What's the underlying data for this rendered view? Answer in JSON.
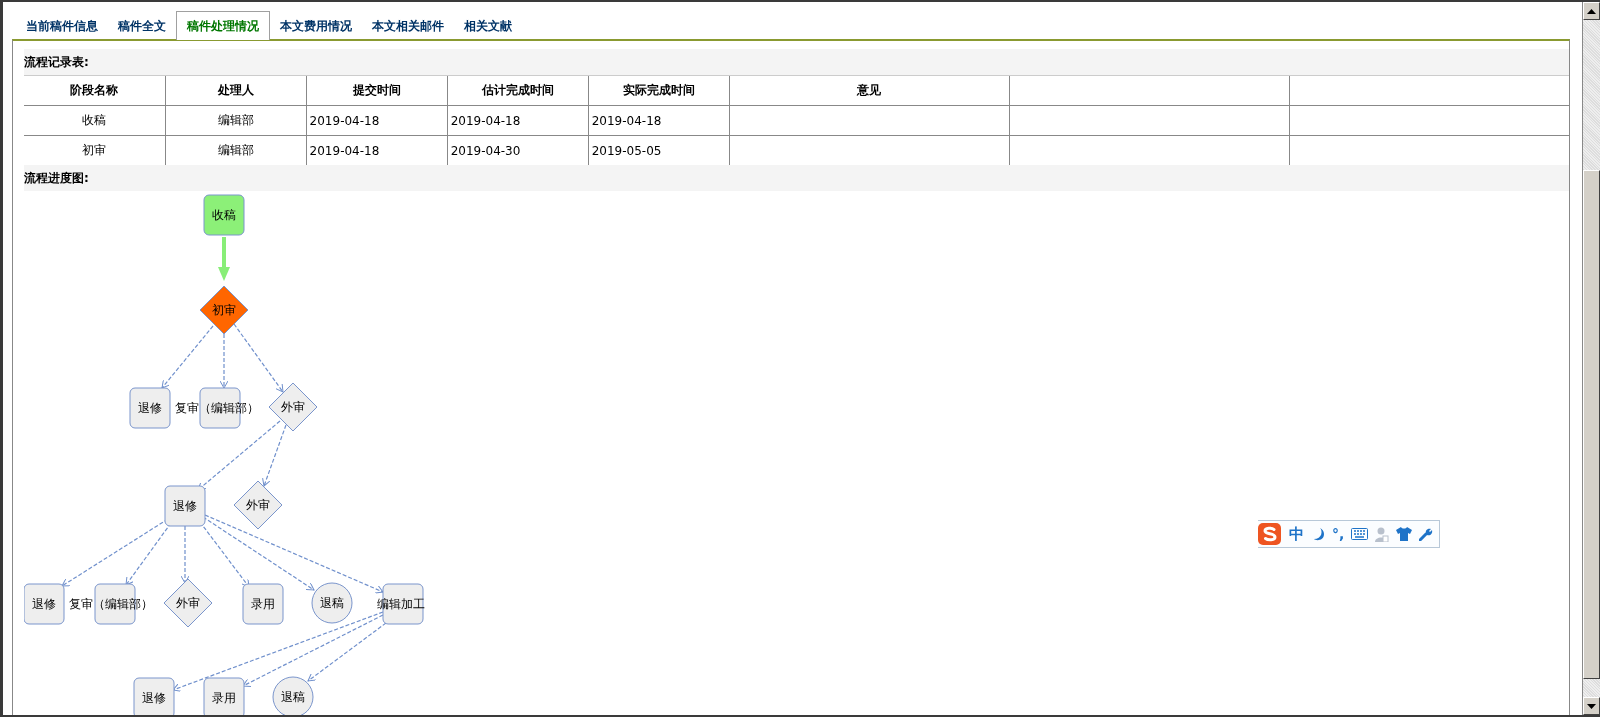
{
  "tabs": [
    {
      "label": "当前稿件信息",
      "selected": false
    },
    {
      "label": "稿件全文",
      "selected": false
    },
    {
      "label": "稿件处理情况",
      "selected": true
    },
    {
      "label": "本文费用情况",
      "selected": false
    },
    {
      "label": "本文相关邮件",
      "selected": false
    },
    {
      "label": "相关文献",
      "selected": false
    }
  ],
  "record_section": {
    "title": "流程记录表:"
  },
  "table": {
    "columns": [
      "阶段名称",
      "处理人",
      "提交时间",
      "估计完成时间",
      "实际完成时间",
      "意见"
    ],
    "rows": [
      [
        "收稿",
        "编辑部",
        "2019-04-18",
        "2019-04-18",
        "2019-04-18"
      ],
      [
        "初审",
        "编辑部",
        "2019-04-18",
        "2019-04-30",
        "2019-05-05"
      ]
    ]
  },
  "progress_section": {
    "title": "流程进度图:"
  },
  "flow": {
    "nodes": [
      {
        "label": "收稿",
        "kind": "rect",
        "done": true,
        "current": false
      },
      {
        "label": "初审",
        "kind": "diamond",
        "done": false,
        "current": true
      },
      {
        "label": "退修",
        "kind": "rect",
        "done": false,
        "current": false
      },
      {
        "label": "复审（编辑部）",
        "kind": "rect",
        "done": false,
        "current": false
      },
      {
        "label": "外审",
        "kind": "diamond",
        "done": false,
        "current": false
      },
      {
        "label": "退修",
        "kind": "rect",
        "done": false,
        "current": false
      },
      {
        "label": "外审",
        "kind": "diamond",
        "done": false,
        "current": false
      },
      {
        "label": "退修",
        "kind": "rect",
        "done": false,
        "current": false
      },
      {
        "label": "复审（编辑部）",
        "kind": "rect",
        "done": false,
        "current": false
      },
      {
        "label": "外审",
        "kind": "diamond",
        "done": false,
        "current": false
      },
      {
        "label": "录用",
        "kind": "rect",
        "done": false,
        "current": false
      },
      {
        "label": "退稿",
        "kind": "circle",
        "done": false,
        "current": false
      },
      {
        "label": "编辑加工",
        "kind": "rect",
        "done": false,
        "current": false
      },
      {
        "label": "退修",
        "kind": "rect",
        "done": false,
        "current": false
      },
      {
        "label": "录用",
        "kind": "rect",
        "done": false,
        "current": false
      },
      {
        "label": "退稿",
        "kind": "circle",
        "done": false,
        "current": false
      }
    ]
  },
  "ime_toolbar": {
    "mode": "中",
    "punctuation": "°,"
  }
}
